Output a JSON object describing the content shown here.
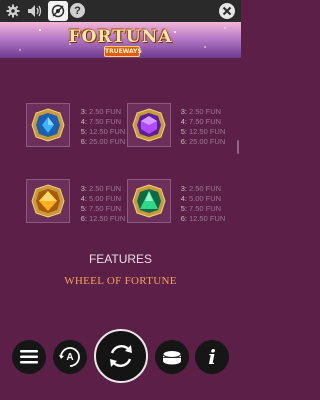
{
  "top_bar": {
    "icons": [
      "gear-icon",
      "speaker-icon",
      "history-icon",
      "help-icon",
      "close-icon"
    ],
    "help_label": "?"
  },
  "header": {
    "logo_text": "FORTUNA",
    "logo_subtext": "TRUEWAYS"
  },
  "paytable": [
    {
      "symbol": "blue-gem-icon",
      "color": "#2f8fe0",
      "payouts": [
        {
          "count": "3:",
          "value": "2.50 FUN"
        },
        {
          "count": "4:",
          "value": "7.50 FUN"
        },
        {
          "count": "5:",
          "value": "12.50 FUN"
        },
        {
          "count": "6:",
          "value": "25.00 FUN"
        }
      ]
    },
    {
      "symbol": "purple-gem-icon",
      "color": "#9b3fe0",
      "payouts": [
        {
          "count": "3:",
          "value": "2.50 FUN"
        },
        {
          "count": "4:",
          "value": "7.50 FUN"
        },
        {
          "count": "5:",
          "value": "12.50 FUN"
        },
        {
          "count": "6:",
          "value": "25.00 FUN"
        }
      ]
    },
    {
      "symbol": "orange-gem-icon",
      "color": "#f0a21a",
      "payouts": [
        {
          "count": "3:",
          "value": "2.50 FUN"
        },
        {
          "count": "4:",
          "value": "5.00 FUN"
        },
        {
          "count": "5:",
          "value": "7.50 FUN"
        },
        {
          "count": "6:",
          "value": "12.50 FUN"
        }
      ]
    },
    {
      "symbol": "green-gem-icon",
      "color": "#2fc07a",
      "payouts": [
        {
          "count": "3:",
          "value": "2.50 FUN"
        },
        {
          "count": "4:",
          "value": "5.00 FUN"
        },
        {
          "count": "5:",
          "value": "7.50 FUN"
        },
        {
          "count": "6:",
          "value": "12.50 FUN"
        }
      ]
    }
  ],
  "sections": {
    "features_heading": "FEATURES",
    "wheel_heading": "WHEEL OF FORTUNE"
  },
  "controls": {
    "icons": [
      "menu-icon",
      "autoplay-icon",
      "spin-icon",
      "bet-coins-icon",
      "info-icon"
    ],
    "autoplay_label": "A",
    "info_label": "i"
  },
  "colors": {
    "background": "#5c2048",
    "accent": "#f2a35b"
  }
}
